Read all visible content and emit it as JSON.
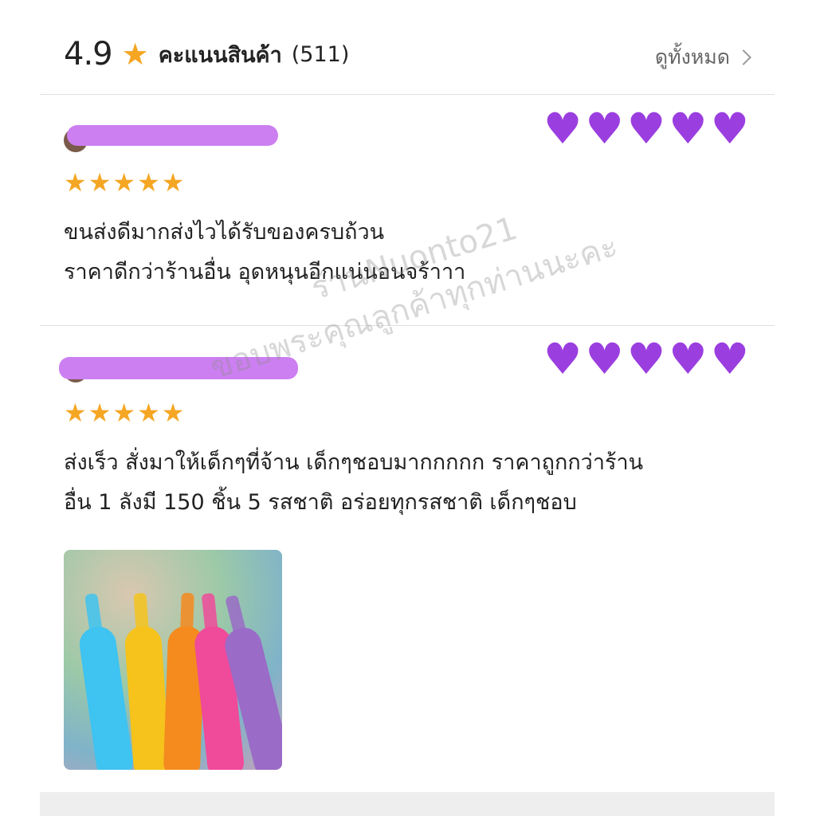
{
  "header": {
    "rating": "4.9",
    "title": "คะแนนสินค้า",
    "count": "(511)",
    "see_all": "ดูทั้งหมด"
  },
  "reviews": [
    {
      "stars": 5,
      "hearts": "💜💜💜💜💜",
      "lines": [
        "ขนส่งดีมากส่งไวได้รับของครบถ้วน",
        "ราคาดีกว่าร้านอื่น อุดหนุนอีกแน่นอนจร้าาา"
      ]
    },
    {
      "stars": 5,
      "hearts": "💜💜💜💜💜",
      "lines": [
        "ส่งเร็ว สั่งมาให้เด็กๆที่จ้าน เด็กๆชอบมากกกกก ราคาถูกกว่าร้าน",
        "อื่น 1 ลังมี 150 ชิ้น 5 รสชาติ อร่อยทุกรสชาติ เด็กๆชอบ"
      ]
    }
  ],
  "watermark": {
    "line1": "ร้านNuonto21",
    "line2": "ขอบพระคุณลูกค้าทุกท่านนะคะ"
  },
  "colors": {
    "star": "#f5a623",
    "heart": "#9b3ee0",
    "name_redaction": "#cc7ff0"
  },
  "icons": {
    "rating_star": "star-icon",
    "see_all": "chevron-right-icon"
  }
}
